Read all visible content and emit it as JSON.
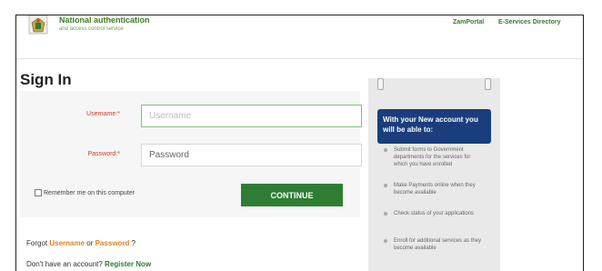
{
  "header": {
    "title": "National authentication",
    "subtitle": "and access control service",
    "nav": [
      "ZamPortal",
      "E-Services Directory"
    ]
  },
  "signin": {
    "title": "Sign In",
    "username_label": "Username:*",
    "username_placeholder": "Username",
    "password_label": "Password:*",
    "password_placeholder": "Password",
    "remember_label": "Remember me on this computer",
    "continue_label": "CONTINUE"
  },
  "links": {
    "forgot_prefix": "Forgot",
    "forgot_username": "Username",
    "forgot_or": "or",
    "forgot_password": "Password",
    "forgot_suffix": "?",
    "no_account": "Don't have an account?",
    "register": "Register Now"
  },
  "side": {
    "heading": "With your New account you will be able to:",
    "benefits": [
      "Submit forms to Government departments for the services for which you have enrolled",
      "Make Payments online when they become available",
      "Check status of your applications",
      "Enroll for additional services as they become available"
    ]
  },
  "colors": {
    "brand_green": "#2e7d32",
    "label_red": "#d23a1e",
    "link_orange": "#e88019",
    "panel_blue": "#1a3d7c"
  },
  "icons": {
    "logo": "coat-of-arms-icon",
    "bullet": "bullet-icon",
    "checkbox": "checkbox-icon",
    "binder": "binder-clip-icon"
  }
}
